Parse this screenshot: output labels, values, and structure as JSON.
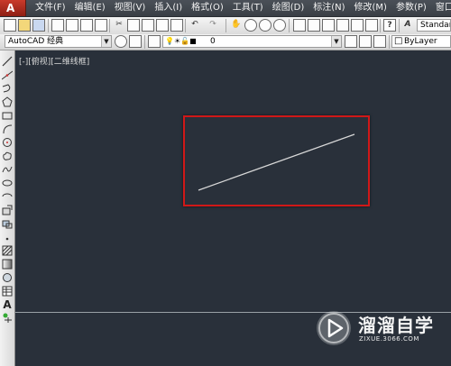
{
  "app": {
    "logo_letter": "A"
  },
  "menu": {
    "items": [
      "文件(F)",
      "编辑(E)",
      "视图(V)",
      "插入(I)",
      "格式(O)",
      "工具(T)",
      "绘图(D)",
      "标注(N)",
      "修改(M)",
      "参数(P)",
      "窗口(W)"
    ]
  },
  "toolbar1": {
    "text_style_combo": "Standard"
  },
  "toolbar2": {
    "workspace_combo": "AutoCAD 经典",
    "layer_combo": "0",
    "color_combo": "ByLayer"
  },
  "canvas": {
    "view_label": "[-][俯视][二维线框]",
    "background": "#29303a",
    "highlight_color": "#d01818",
    "line_color": "#d8d8d8"
  },
  "watermark": {
    "title": "溜溜自学",
    "url": "ZIXUE.3066.COM"
  }
}
